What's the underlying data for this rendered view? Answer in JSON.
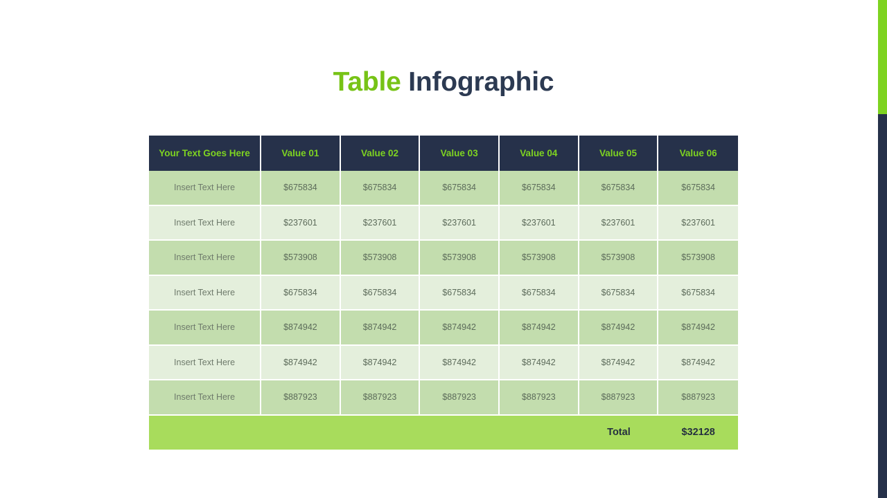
{
  "title": {
    "accent_word": "Table",
    "rest_word": "Infographic"
  },
  "colors": {
    "accent_green": "#7ED321",
    "title_green": "#77C316",
    "header_navy": "#26314A",
    "row_dark": "#C3DDAE",
    "row_light": "#E4EFDC",
    "total_green": "#A8DC5C",
    "body_text": "#5C6B5A"
  },
  "table": {
    "headers": [
      "Your Text Goes Here",
      "Value 01",
      "Value 02",
      "Value 03",
      "Value 04",
      "Value 05",
      "Value 06"
    ],
    "rows": [
      {
        "label": "Insert Text Here",
        "values": [
          "$675834",
          "$675834",
          "$675834",
          "$675834",
          "$675834",
          "$675834"
        ]
      },
      {
        "label": "Insert Text Here",
        "values": [
          "$237601",
          "$237601",
          "$237601",
          "$237601",
          "$237601",
          "$237601"
        ]
      },
      {
        "label": "Insert Text Here",
        "values": [
          "$573908",
          "$573908",
          "$573908",
          "$573908",
          "$573908",
          "$573908"
        ]
      },
      {
        "label": "Insert Text Here",
        "values": [
          "$675834",
          "$675834",
          "$675834",
          "$675834",
          "$675834",
          "$675834"
        ]
      },
      {
        "label": "Insert Text Here",
        "values": [
          "$874942",
          "$874942",
          "$874942",
          "$874942",
          "$874942",
          "$874942"
        ]
      },
      {
        "label": "Insert Text Here",
        "values": [
          "$874942",
          "$874942",
          "$874942",
          "$874942",
          "$874942",
          "$874942"
        ]
      },
      {
        "label": "Insert Text Here",
        "values": [
          "$887923",
          "$887923",
          "$887923",
          "$887923",
          "$887923",
          "$887923"
        ]
      }
    ],
    "total": {
      "label": "Total",
      "value": "$32128"
    }
  }
}
